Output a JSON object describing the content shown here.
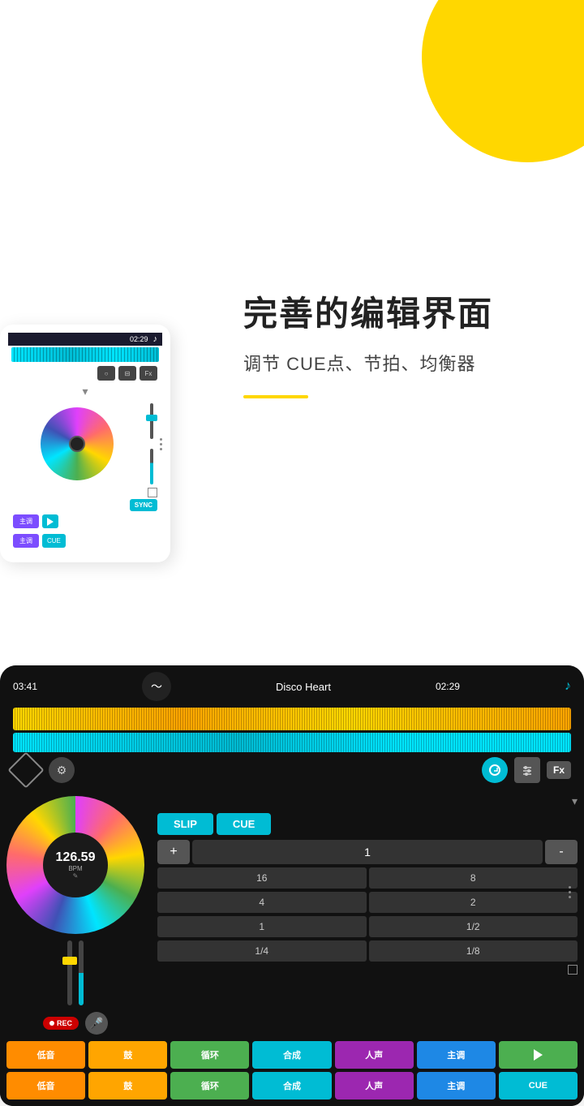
{
  "page": {
    "bg_color": "#ffffff",
    "blob_color": "#FFD700"
  },
  "header": {
    "title": "完善的编辑界面",
    "subtitle": "调节 CUE点、节拍、均衡器",
    "accent_color": "#FFD700"
  },
  "device_left": {
    "time": "02:29",
    "buttons": {
      "sync": "SYNC",
      "main_key_1": "主调",
      "main_key_2": "主调",
      "cue": "CUE",
      "play": "▶"
    },
    "icons": {
      "circle": "○",
      "sliders": "⊟",
      "fx": "Fx"
    }
  },
  "device_bottom": {
    "time_left": "03:41",
    "time_right": "02:29",
    "track_name": "Disco Heart",
    "bpm": "126.59",
    "bpm_label": "BPM",
    "controls": {
      "slip": "SLIP",
      "cue": "CUE",
      "fx": "Fx",
      "plus": "+",
      "minus": "-",
      "beat_1": "1",
      "beat_16": "16",
      "beat_8": "8",
      "beat_4": "4",
      "beat_2": "2",
      "beat_1b": "1",
      "beat_half": "1/2",
      "beat_quarter": "1/4",
      "beat_eighth": "1/8"
    },
    "rec": "●REC",
    "bottom_row1": [
      "低音",
      "鼓",
      "循环",
      "合成",
      "人声",
      "主调",
      "▶"
    ],
    "bottom_row2": [
      "低音",
      "鼓",
      "循环",
      "合成",
      "人声",
      "主调",
      "CUE"
    ],
    "bottom_row1_colors": [
      "btn-orange",
      "btn-yellow",
      "btn-green",
      "btn-teal",
      "btn-purple",
      "btn-blue",
      "btn-play-green"
    ],
    "bottom_row2_colors": [
      "btn-orange",
      "btn-yellow",
      "btn-green",
      "btn-teal",
      "btn-purple",
      "btn-blue",
      "btn-cyan"
    ]
  }
}
